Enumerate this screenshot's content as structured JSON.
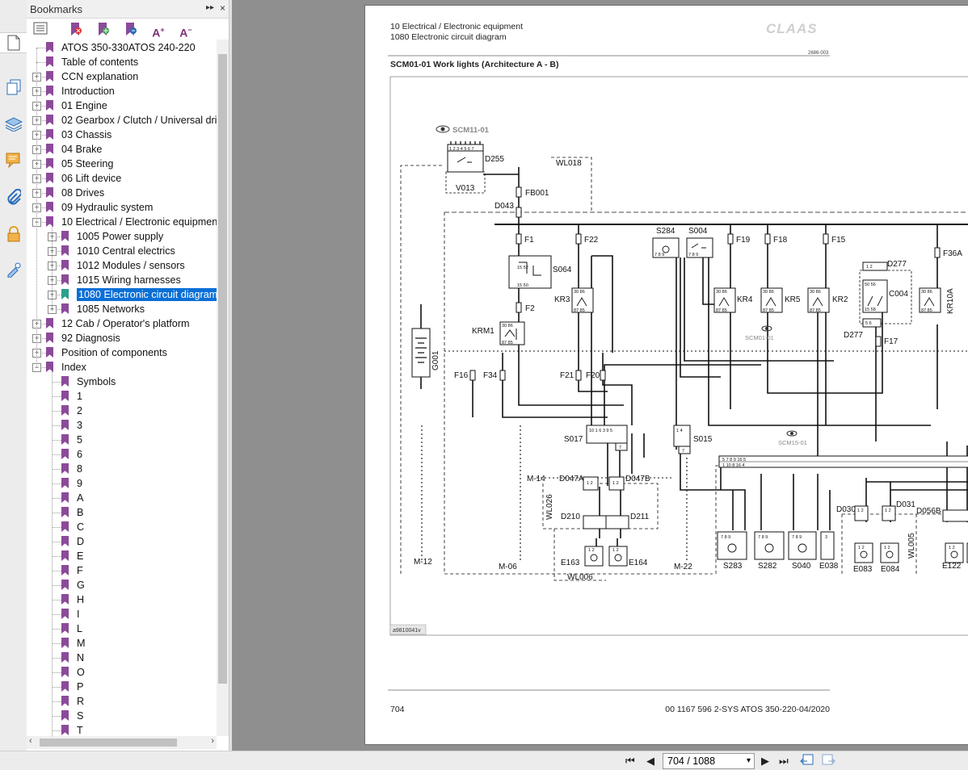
{
  "bookmarks_panel": {
    "title": "Bookmarks",
    "collapse_glyph": "▸▸",
    "close_glyph": "×",
    "tools": [
      "list-options-icon",
      "delete-bookmark-icon",
      "new-bookmark-icon",
      "expand-bookmark-icon",
      "text-larger-icon",
      "text-smaller-icon"
    ],
    "tree": [
      {
        "label": "ATOS 350-330ATOS 240-220",
        "level": 0,
        "expander": "none"
      },
      {
        "label": "Table of contents",
        "level": 0,
        "expander": "none"
      },
      {
        "label": "CCN explanation",
        "level": 0,
        "expander": "+"
      },
      {
        "label": "Introduction",
        "level": 0,
        "expander": "+"
      },
      {
        "label": "01 Engine",
        "level": 0,
        "expander": "+"
      },
      {
        "label": "02 Gearbox / Clutch / Universal driv",
        "level": 0,
        "expander": "+"
      },
      {
        "label": "03 Chassis",
        "level": 0,
        "expander": "+"
      },
      {
        "label": "04 Brake",
        "level": 0,
        "expander": "+"
      },
      {
        "label": "05 Steering",
        "level": 0,
        "expander": "+"
      },
      {
        "label": "06 Lift device",
        "level": 0,
        "expander": "+"
      },
      {
        "label": "08 Drives",
        "level": 0,
        "expander": "+"
      },
      {
        "label": "09 Hydraulic system",
        "level": 0,
        "expander": "+"
      },
      {
        "label": "10 Electrical / Electronic equipment",
        "level": 0,
        "expander": "-"
      },
      {
        "label": "1005 Power supply",
        "level": 1,
        "expander": "+"
      },
      {
        "label": "1010 Central electrics",
        "level": 1,
        "expander": "+"
      },
      {
        "label": "1012 Modules / sensors",
        "level": 1,
        "expander": "+"
      },
      {
        "label": "1015 Wiring harnesses",
        "level": 1,
        "expander": "+"
      },
      {
        "label": "1080 Electronic circuit diagram",
        "level": 1,
        "expander": "+",
        "selected": true
      },
      {
        "label": "1085 Networks",
        "level": 1,
        "expander": "+"
      },
      {
        "label": "12 Cab / Operator's platform",
        "level": 0,
        "expander": "+"
      },
      {
        "label": "92 Diagnosis",
        "level": 0,
        "expander": "+"
      },
      {
        "label": "Position of components",
        "level": 0,
        "expander": "+"
      },
      {
        "label": "Index",
        "level": 0,
        "expander": "-"
      },
      {
        "label": "Symbols",
        "level": 1,
        "expander": "none"
      },
      {
        "label": "1",
        "level": 1,
        "expander": "none"
      },
      {
        "label": "2",
        "level": 1,
        "expander": "none"
      },
      {
        "label": "3",
        "level": 1,
        "expander": "none"
      },
      {
        "label": "5",
        "level": 1,
        "expander": "none"
      },
      {
        "label": "6",
        "level": 1,
        "expander": "none"
      },
      {
        "label": "8",
        "level": 1,
        "expander": "none"
      },
      {
        "label": "9",
        "level": 1,
        "expander": "none"
      },
      {
        "label": "A",
        "level": 1,
        "expander": "none"
      },
      {
        "label": "B",
        "level": 1,
        "expander": "none"
      },
      {
        "label": "C",
        "level": 1,
        "expander": "none"
      },
      {
        "label": "D",
        "level": 1,
        "expander": "none"
      },
      {
        "label": "E",
        "level": 1,
        "expander": "none"
      },
      {
        "label": "F",
        "level": 1,
        "expander": "none"
      },
      {
        "label": "G",
        "level": 1,
        "expander": "none"
      },
      {
        "label": "H",
        "level": 1,
        "expander": "none"
      },
      {
        "label": "I",
        "level": 1,
        "expander": "none"
      },
      {
        "label": "L",
        "level": 1,
        "expander": "none"
      },
      {
        "label": "M",
        "level": 1,
        "expander": "none"
      },
      {
        "label": "N",
        "level": 1,
        "expander": "none"
      },
      {
        "label": "O",
        "level": 1,
        "expander": "none"
      },
      {
        "label": "P",
        "level": 1,
        "expander": "none"
      },
      {
        "label": "R",
        "level": 1,
        "expander": "none"
      },
      {
        "label": "S",
        "level": 1,
        "expander": "none"
      },
      {
        "label": "T",
        "level": 1,
        "expander": "none"
      }
    ]
  },
  "page": {
    "header_line1": "10 Electrical / Electronic equipment",
    "header_line2": "1080 Electronic circuit diagram",
    "brand": "CLAAS",
    "doc_code": "2686-003",
    "section_title": "SCM01-01 Work lights (Architecture A - B)",
    "figure_id": "a9810041v",
    "page_number": "704",
    "footer_ref": "00 1167 596 2-SYS ATOS 350-220-04/2020"
  },
  "schematic": {
    "refs": {
      "scm11": "SCM11-01",
      "scm01": "SCM01-01",
      "scm15": "SCM15-01"
    },
    "components": {
      "d255": "D255",
      "v013": "V013",
      "wl018": "WL018",
      "fb001": "FB001",
      "d043": "D043",
      "f1": "F1",
      "f2": "F2",
      "f22": "F22",
      "f19": "F19",
      "f18": "F18",
      "f15": "F15",
      "f36a": "F36A",
      "f17": "F17",
      "f16": "F16",
      "f34": "F34",
      "f21": "F21",
      "f20": "F20",
      "s064": "S064",
      "s284": "S284",
      "s004": "S004",
      "d277a": "D277",
      "d277b": "D277",
      "c004": "C004",
      "krm1": "KRM1",
      "kr3": "KR3",
      "kr4": "KR4",
      "kr5": "KR5",
      "kr2": "KR2",
      "kr10a": "KR10A",
      "g001": "G001",
      "s017": "S017",
      "s015": "S015",
      "m14": "M-14",
      "m12": "M-12",
      "m06": "M-06",
      "m22": "M-22",
      "d047a": "D047A",
      "d047b": "D047B",
      "wl026": "WL026",
      "d210": "D210",
      "d211": "D211",
      "e163": "E163",
      "e164": "E164",
      "wl006": "WL006",
      "s283": "S283",
      "s282": "S282",
      "s040": "S040",
      "e038": "E038",
      "d030": "D030",
      "d031": "D031",
      "d056b": "D056B",
      "e083": "E083",
      "e084": "E084",
      "wl005": "WL005",
      "e122": "E122"
    },
    "pins": {
      "d255": "1 2 3 4 5 6 7",
      "s064_top": "15 52",
      "s064_bot": "15 50",
      "r3086": "30 86",
      "r8785": "87 85",
      "sw_a": "2 4",
      "sw_b": "1 5 6",
      "sw_c": "7 8 9",
      "s017_top": "10 1 6 3 9 5",
      "s017_bot": "7",
      "s015_top": "1 4",
      "s015_bot": "7",
      "bus_top": "5 7 8 9 16 5",
      "bus_bot": "1 10 8 16 4",
      "d277": "1 2",
      "c004_a": "50 56",
      "c004_b": "15 58",
      "d277b_pins": "5 6",
      "con2": "1 2",
      "con3": "7 8 9",
      "con_1": "3"
    }
  },
  "toolbar": {
    "first": "⏮",
    "prev": "◀",
    "next": "▶",
    "last": "⏭",
    "page_indicator": "704 / 1088",
    "dropdown_glyph": "▾"
  }
}
